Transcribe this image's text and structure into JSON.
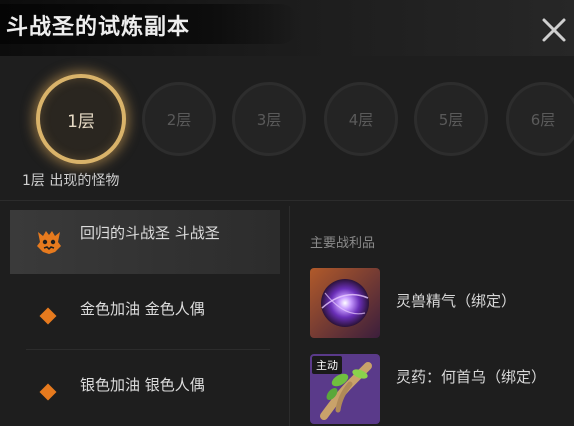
{
  "header": {
    "title": "斗战圣的试炼副本"
  },
  "floors": [
    "1层",
    "2层",
    "3层",
    "4层",
    "5层",
    "6层"
  ],
  "active_floor_index": 0,
  "floor_caption": "1层 出现的怪物",
  "monsters": [
    {
      "label": "回归的斗战圣 斗战圣",
      "icon": "demon-face-icon",
      "selected": true
    },
    {
      "label": "金色加油 金色人偶",
      "icon": "orange-diamond-icon",
      "selected": false
    },
    {
      "label": "银色加油 银色人偶",
      "icon": "orange-diamond-icon",
      "selected": false
    }
  ],
  "loot": {
    "title": "主要战利品",
    "items": [
      {
        "label": "灵兽精气（绑定）",
        "icon": "purple-orb-icon"
      },
      {
        "label": "灵药：何首乌（绑定）",
        "icon": "herb-root-icon",
        "tag": "主动"
      }
    ]
  },
  "colors": {
    "accent_gold": "#d9b36a",
    "diamond_orange": "#e67a1e",
    "background": "#1e1e1e"
  }
}
